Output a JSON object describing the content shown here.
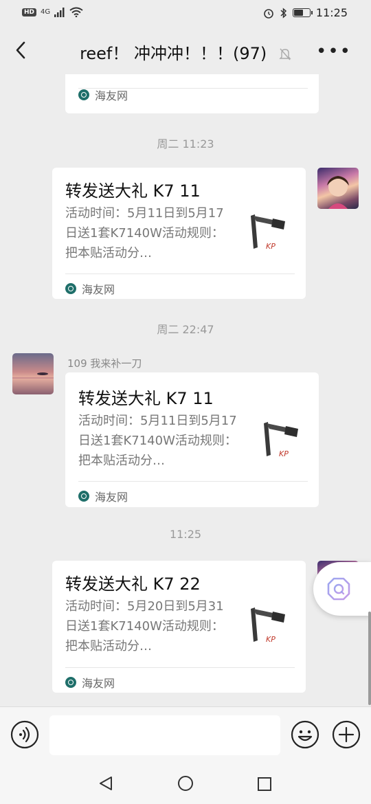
{
  "status_bar": {
    "hd": "HD",
    "network": "4G",
    "time": "11:25"
  },
  "header": {
    "title": "reef！ 冲冲冲！！！(97)"
  },
  "messages": {
    "top_partial": {
      "source": "海友网"
    },
    "ts1": "周二 11:23",
    "card1": {
      "title": "转发送大礼 K7 11",
      "desc": "活动时间：5月11日到5月17日送1套K7140W活动规则：把本贴活动分…",
      "source": "海友网"
    },
    "ts2": "周二 22:47",
    "card2": {
      "sender": "109 我来补一刀",
      "title": "转发送大礼 K7 11",
      "desc": "活动时间：5月11日到5月17日送1套K7140W活动规则：把本贴活动分…",
      "source": "海友网"
    },
    "ts3": "11:25",
    "card3": {
      "title": "转发送大礼 K7 22",
      "desc": "活动时间：5月20日到5月31日送1套K7140W活动规则：把本贴活动分…",
      "source": "海友网"
    }
  },
  "icons": {
    "back": "chevron-left-icon",
    "mute": "bell-off-icon",
    "more": "more-dots-icon",
    "voice": "voice-icon",
    "emoji": "emoji-icon",
    "plus": "plus-icon"
  },
  "colors": {
    "background": "#ededed",
    "bubble": "#ffffff",
    "source_icon": "#1f6f6a"
  }
}
